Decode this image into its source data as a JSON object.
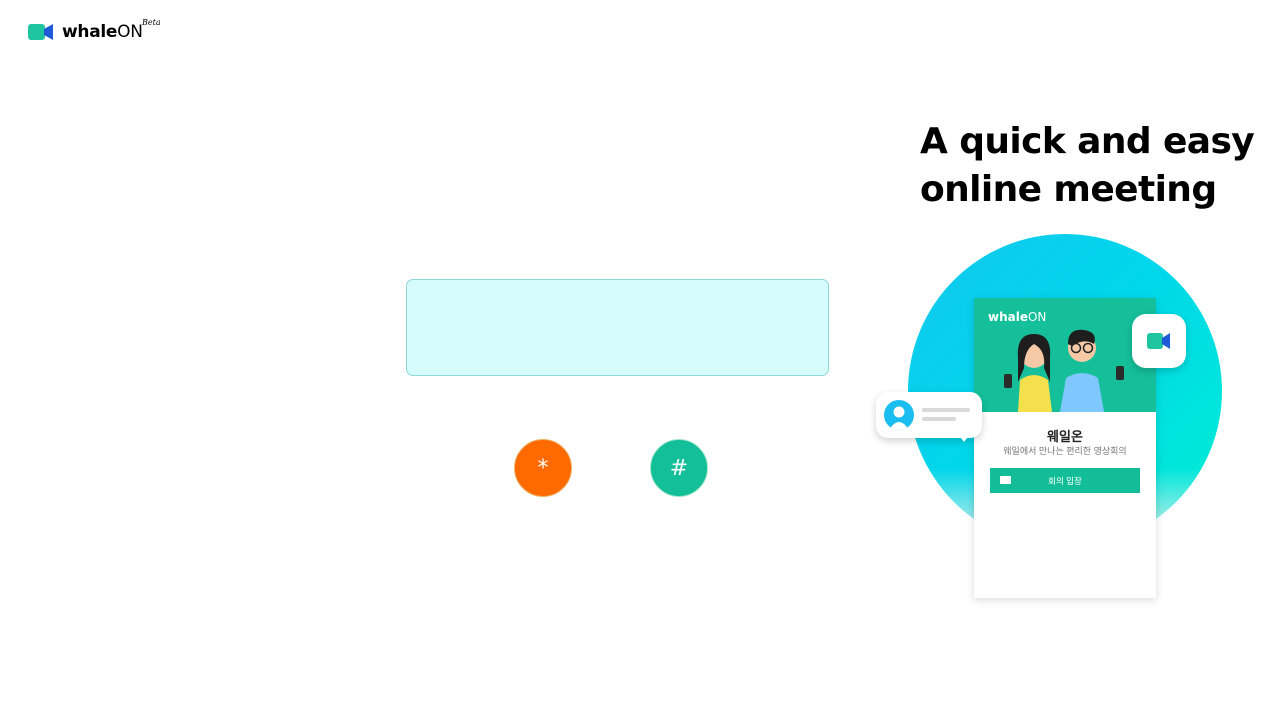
{
  "header": {
    "logo_bold": "whale",
    "logo_regular": "ON",
    "logo_beta": "Beta"
  },
  "meeting_code": {
    "value": "",
    "star_key": "*",
    "hash_key": "#"
  },
  "hero": {
    "headline_line1": "A quick and easy",
    "headline_line2": "online meeting"
  },
  "illustration": {
    "phone_title": "웨일온",
    "phone_subtitle": "웨일에서 만나는 편리한 영상회의",
    "phone_button": "회의 입장",
    "phone_logo_bold": "whale",
    "phone_logo_regular": "ON"
  },
  "colors": {
    "brand_green": "#14bf9a",
    "star_orange": "#ff6a00",
    "code_box_bg": "#d6fdfb"
  },
  "icons": {
    "logo": "video-camera-icon",
    "camera_bubble": "video-camera-icon",
    "avatar": "user-avatar-icon"
  }
}
